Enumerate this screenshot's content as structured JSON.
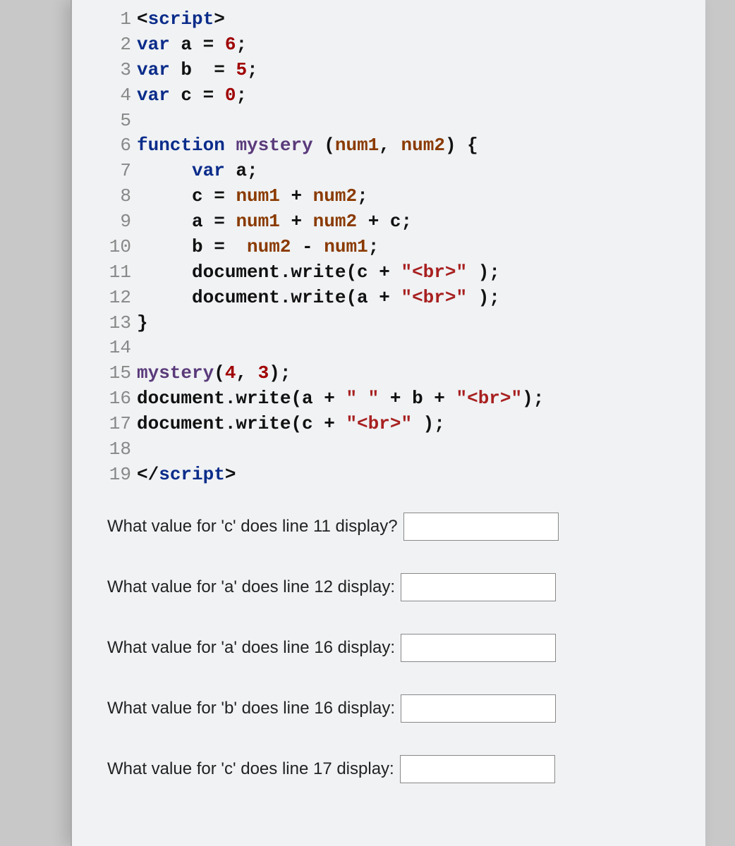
{
  "code": {
    "lines": [
      {
        "n": "1",
        "tokens": [
          {
            "t": "op",
            "v": "<"
          },
          {
            "t": "kw",
            "v": "script"
          },
          {
            "t": "op",
            "v": ">"
          }
        ]
      },
      {
        "n": "2",
        "tokens": [
          {
            "t": "kw",
            "v": "var"
          },
          {
            "t": "op",
            "v": " a = "
          },
          {
            "t": "num",
            "v": "6"
          },
          {
            "t": "op",
            "v": ";"
          }
        ]
      },
      {
        "n": "3",
        "tokens": [
          {
            "t": "kw",
            "v": "var"
          },
          {
            "t": "op",
            "v": " b  = "
          },
          {
            "t": "num",
            "v": "5"
          },
          {
            "t": "op",
            "v": ";"
          }
        ]
      },
      {
        "n": "4",
        "tokens": [
          {
            "t": "kw",
            "v": "var"
          },
          {
            "t": "op",
            "v": " c = "
          },
          {
            "t": "num",
            "v": "0"
          },
          {
            "t": "op",
            "v": ";"
          }
        ]
      },
      {
        "n": "5",
        "tokens": []
      },
      {
        "n": "6",
        "tokens": [
          {
            "t": "kw",
            "v": "function"
          },
          {
            "t": "op",
            "v": " "
          },
          {
            "t": "fn",
            "v": "mystery"
          },
          {
            "t": "op",
            "v": " ("
          },
          {
            "t": "var",
            "v": "num1"
          },
          {
            "t": "op",
            "v": ", "
          },
          {
            "t": "var",
            "v": "num2"
          },
          {
            "t": "op",
            "v": ") {"
          }
        ]
      },
      {
        "n": "7",
        "tokens": [
          {
            "t": "op",
            "v": "     "
          },
          {
            "t": "kw",
            "v": "var"
          },
          {
            "t": "op",
            "v": " a;"
          }
        ]
      },
      {
        "n": "8",
        "tokens": [
          {
            "t": "op",
            "v": "     c = "
          },
          {
            "t": "var",
            "v": "num1"
          },
          {
            "t": "op",
            "v": " + "
          },
          {
            "t": "var",
            "v": "num2"
          },
          {
            "t": "op",
            "v": ";"
          }
        ]
      },
      {
        "n": "9",
        "tokens": [
          {
            "t": "op",
            "v": "     a = "
          },
          {
            "t": "var",
            "v": "num1"
          },
          {
            "t": "op",
            "v": " + "
          },
          {
            "t": "var",
            "v": "num2"
          },
          {
            "t": "op",
            "v": " + c;"
          }
        ]
      },
      {
        "n": "10",
        "tokens": [
          {
            "t": "op",
            "v": "     b =  "
          },
          {
            "t": "var",
            "v": "num2"
          },
          {
            "t": "op",
            "v": " - "
          },
          {
            "t": "var",
            "v": "num1"
          },
          {
            "t": "op",
            "v": ";"
          }
        ]
      },
      {
        "n": "11",
        "tokens": [
          {
            "t": "op",
            "v": "     document.write(c + "
          },
          {
            "t": "str",
            "v": "\"<br>\""
          },
          {
            "t": "op",
            "v": " );"
          }
        ]
      },
      {
        "n": "12",
        "tokens": [
          {
            "t": "op",
            "v": "     document.write(a + "
          },
          {
            "t": "str",
            "v": "\"<br>\""
          },
          {
            "t": "op",
            "v": " );"
          }
        ]
      },
      {
        "n": "13",
        "tokens": [
          {
            "t": "op",
            "v": "}"
          }
        ]
      },
      {
        "n": "14",
        "tokens": []
      },
      {
        "n": "15",
        "tokens": [
          {
            "t": "fn",
            "v": "mystery"
          },
          {
            "t": "op",
            "v": "("
          },
          {
            "t": "num",
            "v": "4"
          },
          {
            "t": "op",
            "v": ", "
          },
          {
            "t": "num",
            "v": "3"
          },
          {
            "t": "op",
            "v": ");"
          }
        ]
      },
      {
        "n": "16",
        "tokens": [
          {
            "t": "op",
            "v": "document.write(a + "
          },
          {
            "t": "str",
            "v": "\" \""
          },
          {
            "t": "op",
            "v": " + b + "
          },
          {
            "t": "str",
            "v": "\"<br>\""
          },
          {
            "t": "op",
            "v": ");"
          }
        ]
      },
      {
        "n": "17",
        "tokens": [
          {
            "t": "op",
            "v": "document.write(c + "
          },
          {
            "t": "str",
            "v": "\"<br>\""
          },
          {
            "t": "op",
            "v": " );"
          }
        ]
      },
      {
        "n": "18",
        "tokens": []
      },
      {
        "n": "19",
        "tokens": [
          {
            "t": "op",
            "v": "</"
          },
          {
            "t": "kw",
            "v": "script"
          },
          {
            "t": "op",
            "v": ">"
          }
        ]
      }
    ]
  },
  "questions": [
    {
      "label": "What value for 'c' does line 11 display?",
      "value": ""
    },
    {
      "label": "What value for 'a' does line 12 display:",
      "value": ""
    },
    {
      "label": "What value for 'a' does line 16 display:",
      "value": ""
    },
    {
      "label": "What value for 'b' does line 16 display:",
      "value": ""
    },
    {
      "label": "What value for 'c' does line 17 display:",
      "value": ""
    }
  ]
}
